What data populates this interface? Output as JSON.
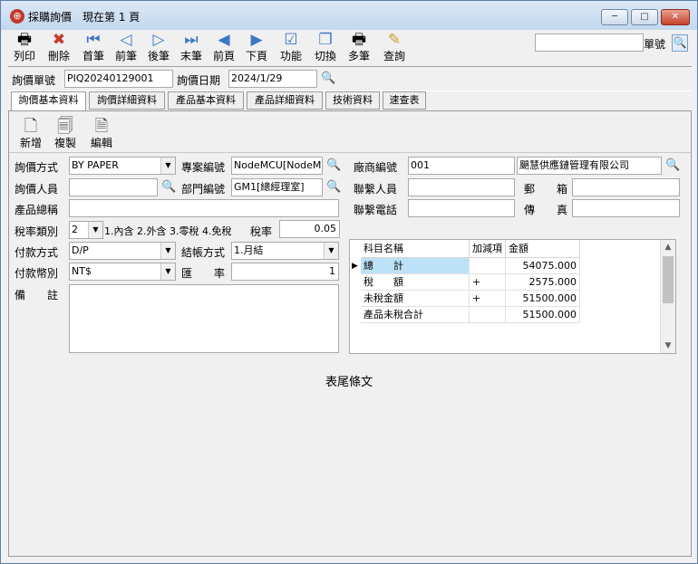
{
  "window": {
    "title": "採購詢價",
    "page_status": "現在第 1 頁",
    "min_label": "─",
    "max_label": "□",
    "close_label": "✕"
  },
  "toolbar": [
    {
      "name": "print",
      "label": "列印",
      "icon": "🖶"
    },
    {
      "name": "delete",
      "label": "刪除",
      "icon": "✖"
    },
    {
      "name": "first",
      "label": "首筆",
      "icon": "⏮"
    },
    {
      "name": "prev",
      "label": "前筆",
      "icon": "◁"
    },
    {
      "name": "next",
      "label": "後筆",
      "icon": "▷"
    },
    {
      "name": "last",
      "label": "末筆",
      "icon": "⏭"
    },
    {
      "name": "prev-page",
      "label": "前頁",
      "icon": "◀"
    },
    {
      "name": "next-page",
      "label": "下頁",
      "icon": "▶"
    },
    {
      "name": "function",
      "label": "功能",
      "icon": "☑"
    },
    {
      "name": "switch",
      "label": "切換",
      "icon": "❐"
    },
    {
      "name": "multi",
      "label": "多筆",
      "icon": "🖶"
    },
    {
      "name": "query",
      "label": "查詢",
      "icon": "✎"
    }
  ],
  "search": {
    "value": "",
    "label": "單號",
    "icon": "🔍"
  },
  "header": {
    "no_label": "詢價單號",
    "no_value": "PIQ20240129001",
    "date_label": "詢價日期",
    "date_value": "2024/1/29",
    "lookup_icon": "🔍"
  },
  "tabs": [
    {
      "label": "詢價基本資料",
      "active": true
    },
    {
      "label": "詢價詳細資料",
      "active": false
    },
    {
      "label": "產品基本資料",
      "active": false
    },
    {
      "label": "產品詳細資料",
      "active": false
    },
    {
      "label": "技術資料",
      "active": false
    },
    {
      "label": "速查表",
      "active": false
    }
  ],
  "panel_toolbar": [
    {
      "name": "new",
      "label": "新增",
      "icon": "🗋"
    },
    {
      "name": "copy",
      "label": "複製",
      "icon": "🗐"
    },
    {
      "name": "edit",
      "label": "編輯",
      "icon": "🗎"
    }
  ],
  "form": {
    "method_label": "詢價方式",
    "method_value": "BY PAPER",
    "project_label": "專案編號",
    "project_value": "NodeMCU[NodeMCU",
    "vendor_label": "廠商編號",
    "vendor_no": "001",
    "vendor_name": "颶慧供應鏈管理有限公司",
    "person_label": "詢價人員",
    "person_value": "",
    "dept_label": "部門編號",
    "dept_value": "GM1[總經理室]",
    "contact_label": "聯繫人員",
    "contact_value": "",
    "postal_label": "郵　　箱",
    "postal_value": "",
    "product_label": "產品總稱",
    "product_value": "",
    "phone_label": "聯繫電話",
    "phone_value": "",
    "fax_label": "傳　　真",
    "fax_value": "",
    "taxtype_label": "稅率類別",
    "taxtype_value": "2",
    "taxtype_desc": "1.內含 2.外含 3.零稅 4.免稅",
    "taxrate_label": "稅率",
    "taxrate_value": "0.05",
    "payment_label": "付款方式",
    "payment_value": "D/P",
    "billing_label": "結帳方式",
    "billing_value": "1.月結",
    "currency_label": "付款幣別",
    "currency_value": "NT$",
    "exrate_label": "匯　　率",
    "exrate_value": "1",
    "remark_label": "備　　註",
    "remark_value": ""
  },
  "grid": {
    "columns": [
      "科目名稱",
      "加減項",
      "金額"
    ],
    "rows": [
      {
        "name": "總　　計",
        "sign": "",
        "amount": "54075.000"
      },
      {
        "name": "稅　　額",
        "sign": "+",
        "amount": "2575.000"
      },
      {
        "name": "未稅金額",
        "sign": "+",
        "amount": "51500.000"
      },
      {
        "name": "產品未稅合計",
        "sign": "",
        "amount": "51500.000"
      }
    ]
  },
  "footer_text": "表尾條文"
}
